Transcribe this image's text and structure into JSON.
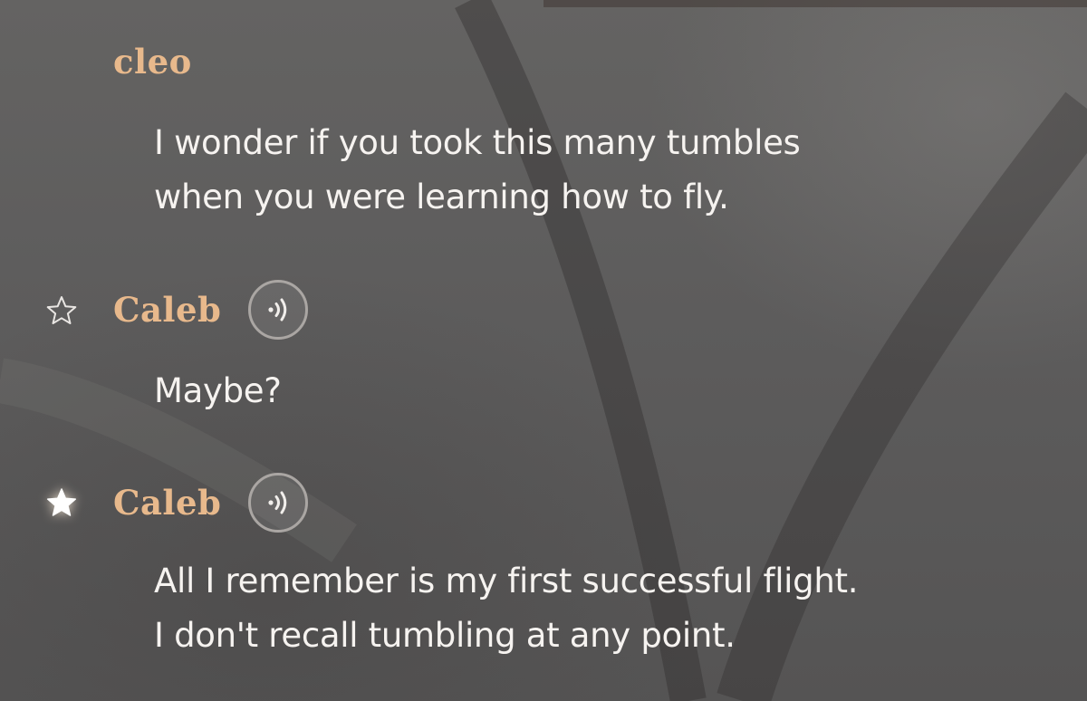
{
  "messages": [
    {
      "speaker": "cleo",
      "starred": null,
      "has_voice": false,
      "lines": [
        "I wonder if you took this many tumbles",
        "when you were learning how to fly."
      ]
    },
    {
      "speaker": "Caleb",
      "starred": false,
      "has_voice": true,
      "lines": [
        "Maybe?"
      ]
    },
    {
      "speaker": "Caleb",
      "starred": true,
      "has_voice": true,
      "lines": [
        "All I remember is my first successful flight.",
        "I don't recall tumbling at any point."
      ]
    }
  ],
  "colors": {
    "speaker_name": "#e8b98c",
    "message_text": "#f6f3f0",
    "background": "#5f5e5d"
  },
  "icons": {
    "favorite_off": "star-outline-icon",
    "favorite_on": "star-filled-icon",
    "voice": "voice-playback-icon"
  }
}
